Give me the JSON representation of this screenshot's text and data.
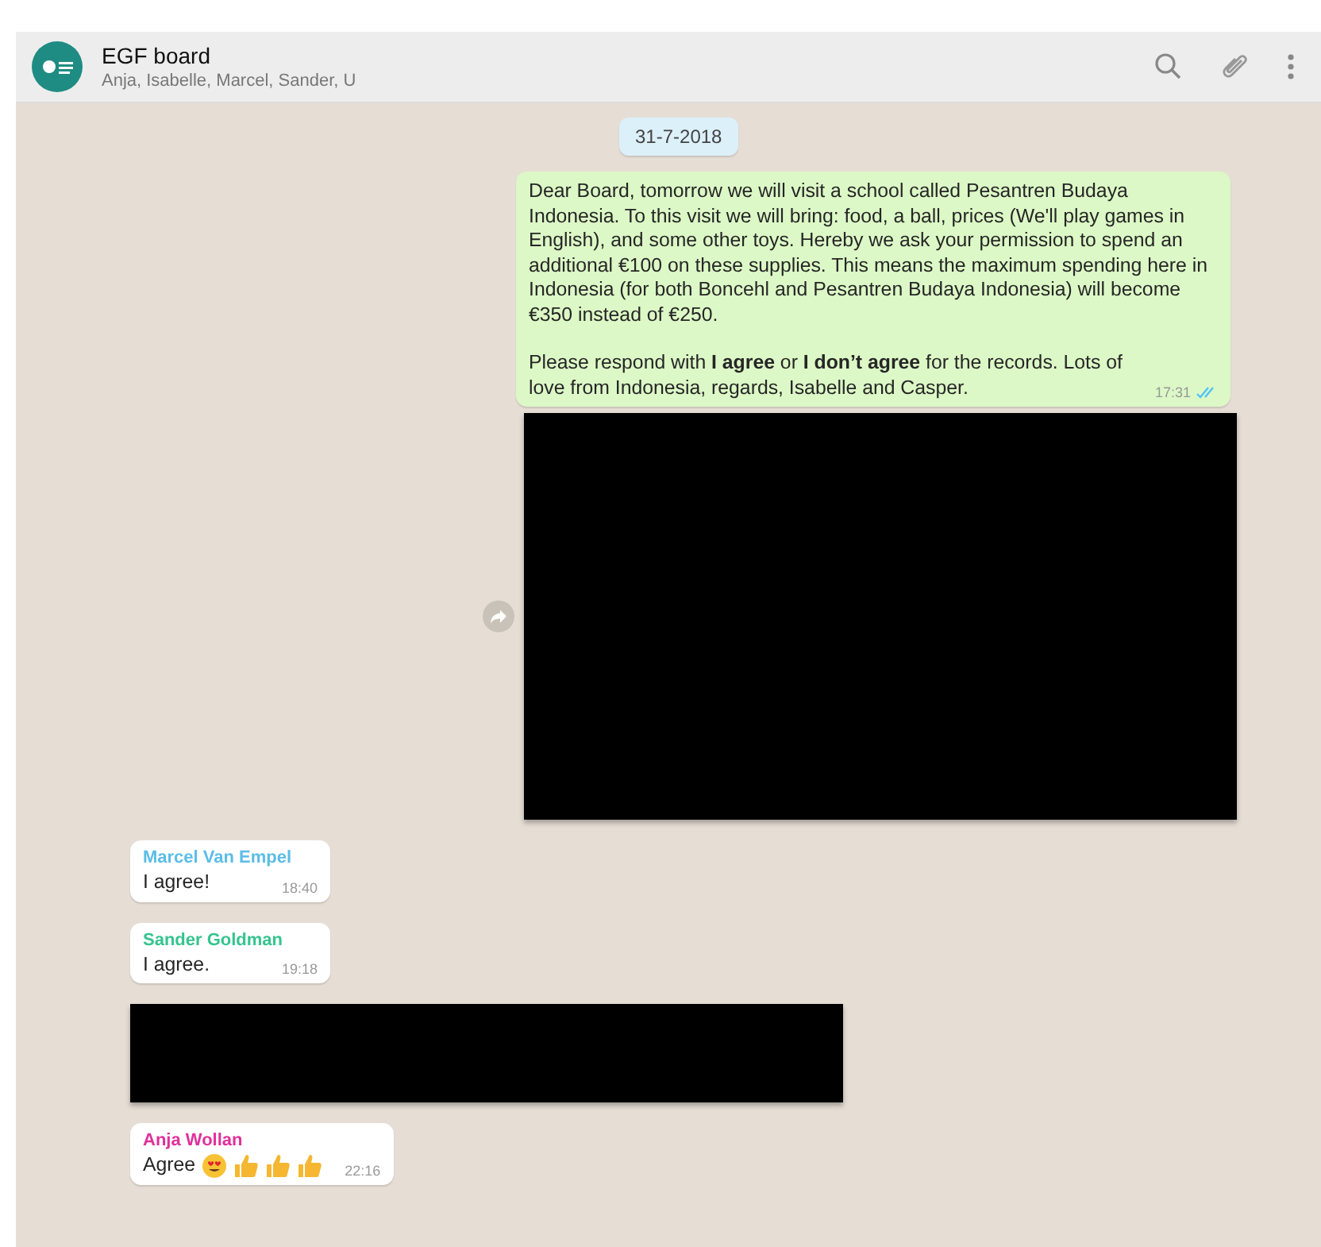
{
  "header": {
    "title": "EGF board",
    "members": "Anja, Isabelle, Marcel, Sander, U"
  },
  "date_divider": "31-7-2018",
  "messages": [
    {
      "kind": "text",
      "outgoing": true,
      "paragraphs": [
        "Dear Board, tomorrow we will visit a school called Pesantren Budaya Indonesia. To this visit we will bring: food, a ball, prices (We'll play games in English), and some other toys. Hereby we ask your permission to spend an additional €100 on these supplies. This means the maximum spending here in Indonesia (for both Boncehl and Pesantren Budaya Indonesia) will become €350 instead of €250.",
        "Please respond with **I agree** or **I don’t agree** for the records. Lots of love from Indonesia, regards, Isabelle and Casper."
      ],
      "time": "17:31",
      "read": true
    },
    {
      "kind": "media",
      "outgoing": true
    },
    {
      "kind": "text",
      "outgoing": false,
      "sender": "Marcel Van Empel",
      "color": "#5bbde8",
      "paragraphs": [
        "I agree!"
      ],
      "time": "18:40"
    },
    {
      "kind": "text",
      "outgoing": false,
      "sender": "Sander Goldman",
      "color": "#35c48e",
      "paragraphs": [
        "I agree."
      ],
      "time": "19:18"
    },
    {
      "kind": "media",
      "outgoing": false
    },
    {
      "kind": "text",
      "outgoing": false,
      "sender": "Anja Wollan",
      "color": "#e0309a",
      "paragraphs": [
        "Agree"
      ],
      "emoji": [
        {
          "kind": "heart-eyes"
        },
        {
          "kind": "thumbs-up"
        },
        {
          "kind": "thumbs-up"
        },
        {
          "kind": "thumbs-up"
        }
      ],
      "time": "22:16"
    }
  ]
}
